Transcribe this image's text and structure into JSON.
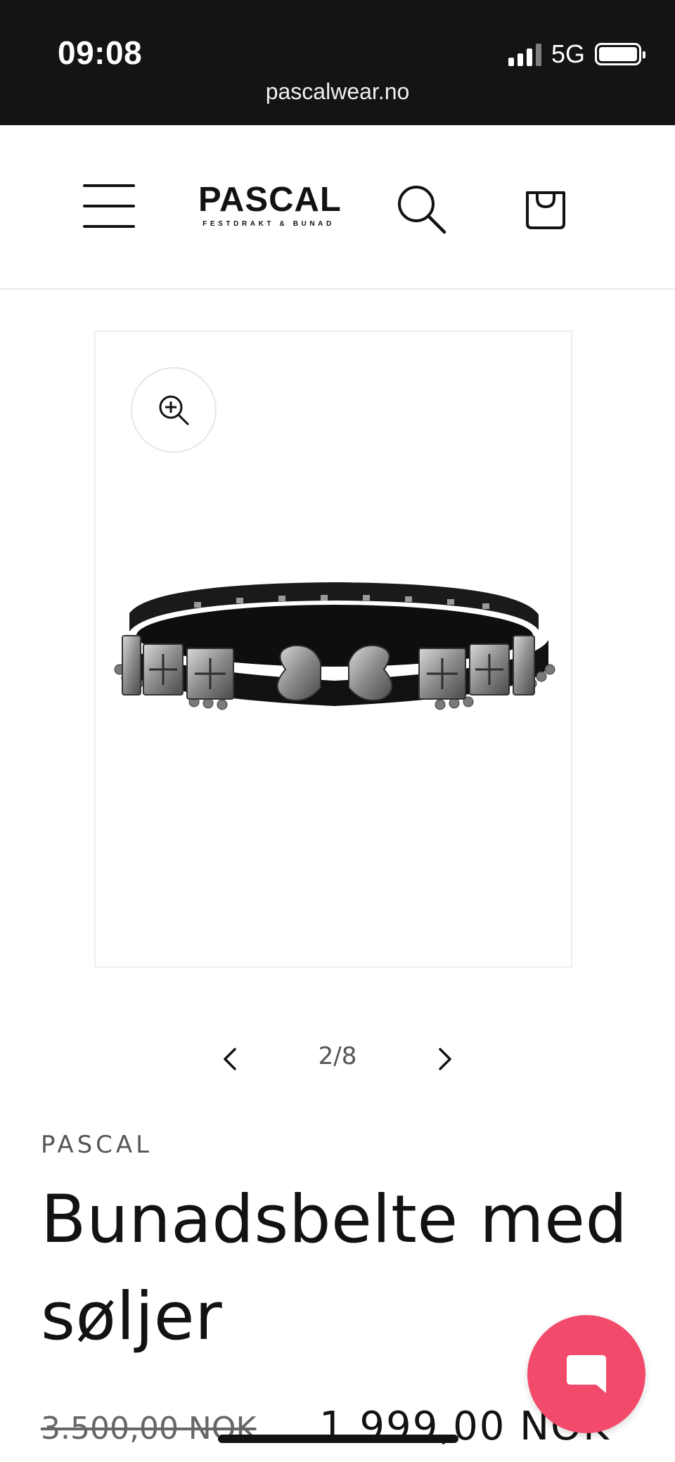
{
  "status_bar": {
    "time": "09:08",
    "network": "5G",
    "url": "pascalwear.no",
    "icons": [
      "signal-icon",
      "battery-icon"
    ]
  },
  "header": {
    "logo_main": "PASCAL",
    "logo_sub": "FESTDRAKT & BUNAD",
    "icons": [
      "menu-icon",
      "search-icon",
      "cart-icon"
    ]
  },
  "media": {
    "zoom_icon": "zoom-in-icon",
    "image": "belt-with-silver-buckles"
  },
  "slider": {
    "counter": "2/8",
    "prev_icon": "chevron-left-icon",
    "next_icon": "chevron-right-icon"
  },
  "product": {
    "vendor": "PASCAL",
    "title": "Bunadsbelte med søljer",
    "compare_price": "3.500,00 NOK",
    "sale_price": "1.999,00 NOK"
  },
  "chat": {
    "icon": "chat-bubble-icon",
    "color": "#f24a6a"
  }
}
